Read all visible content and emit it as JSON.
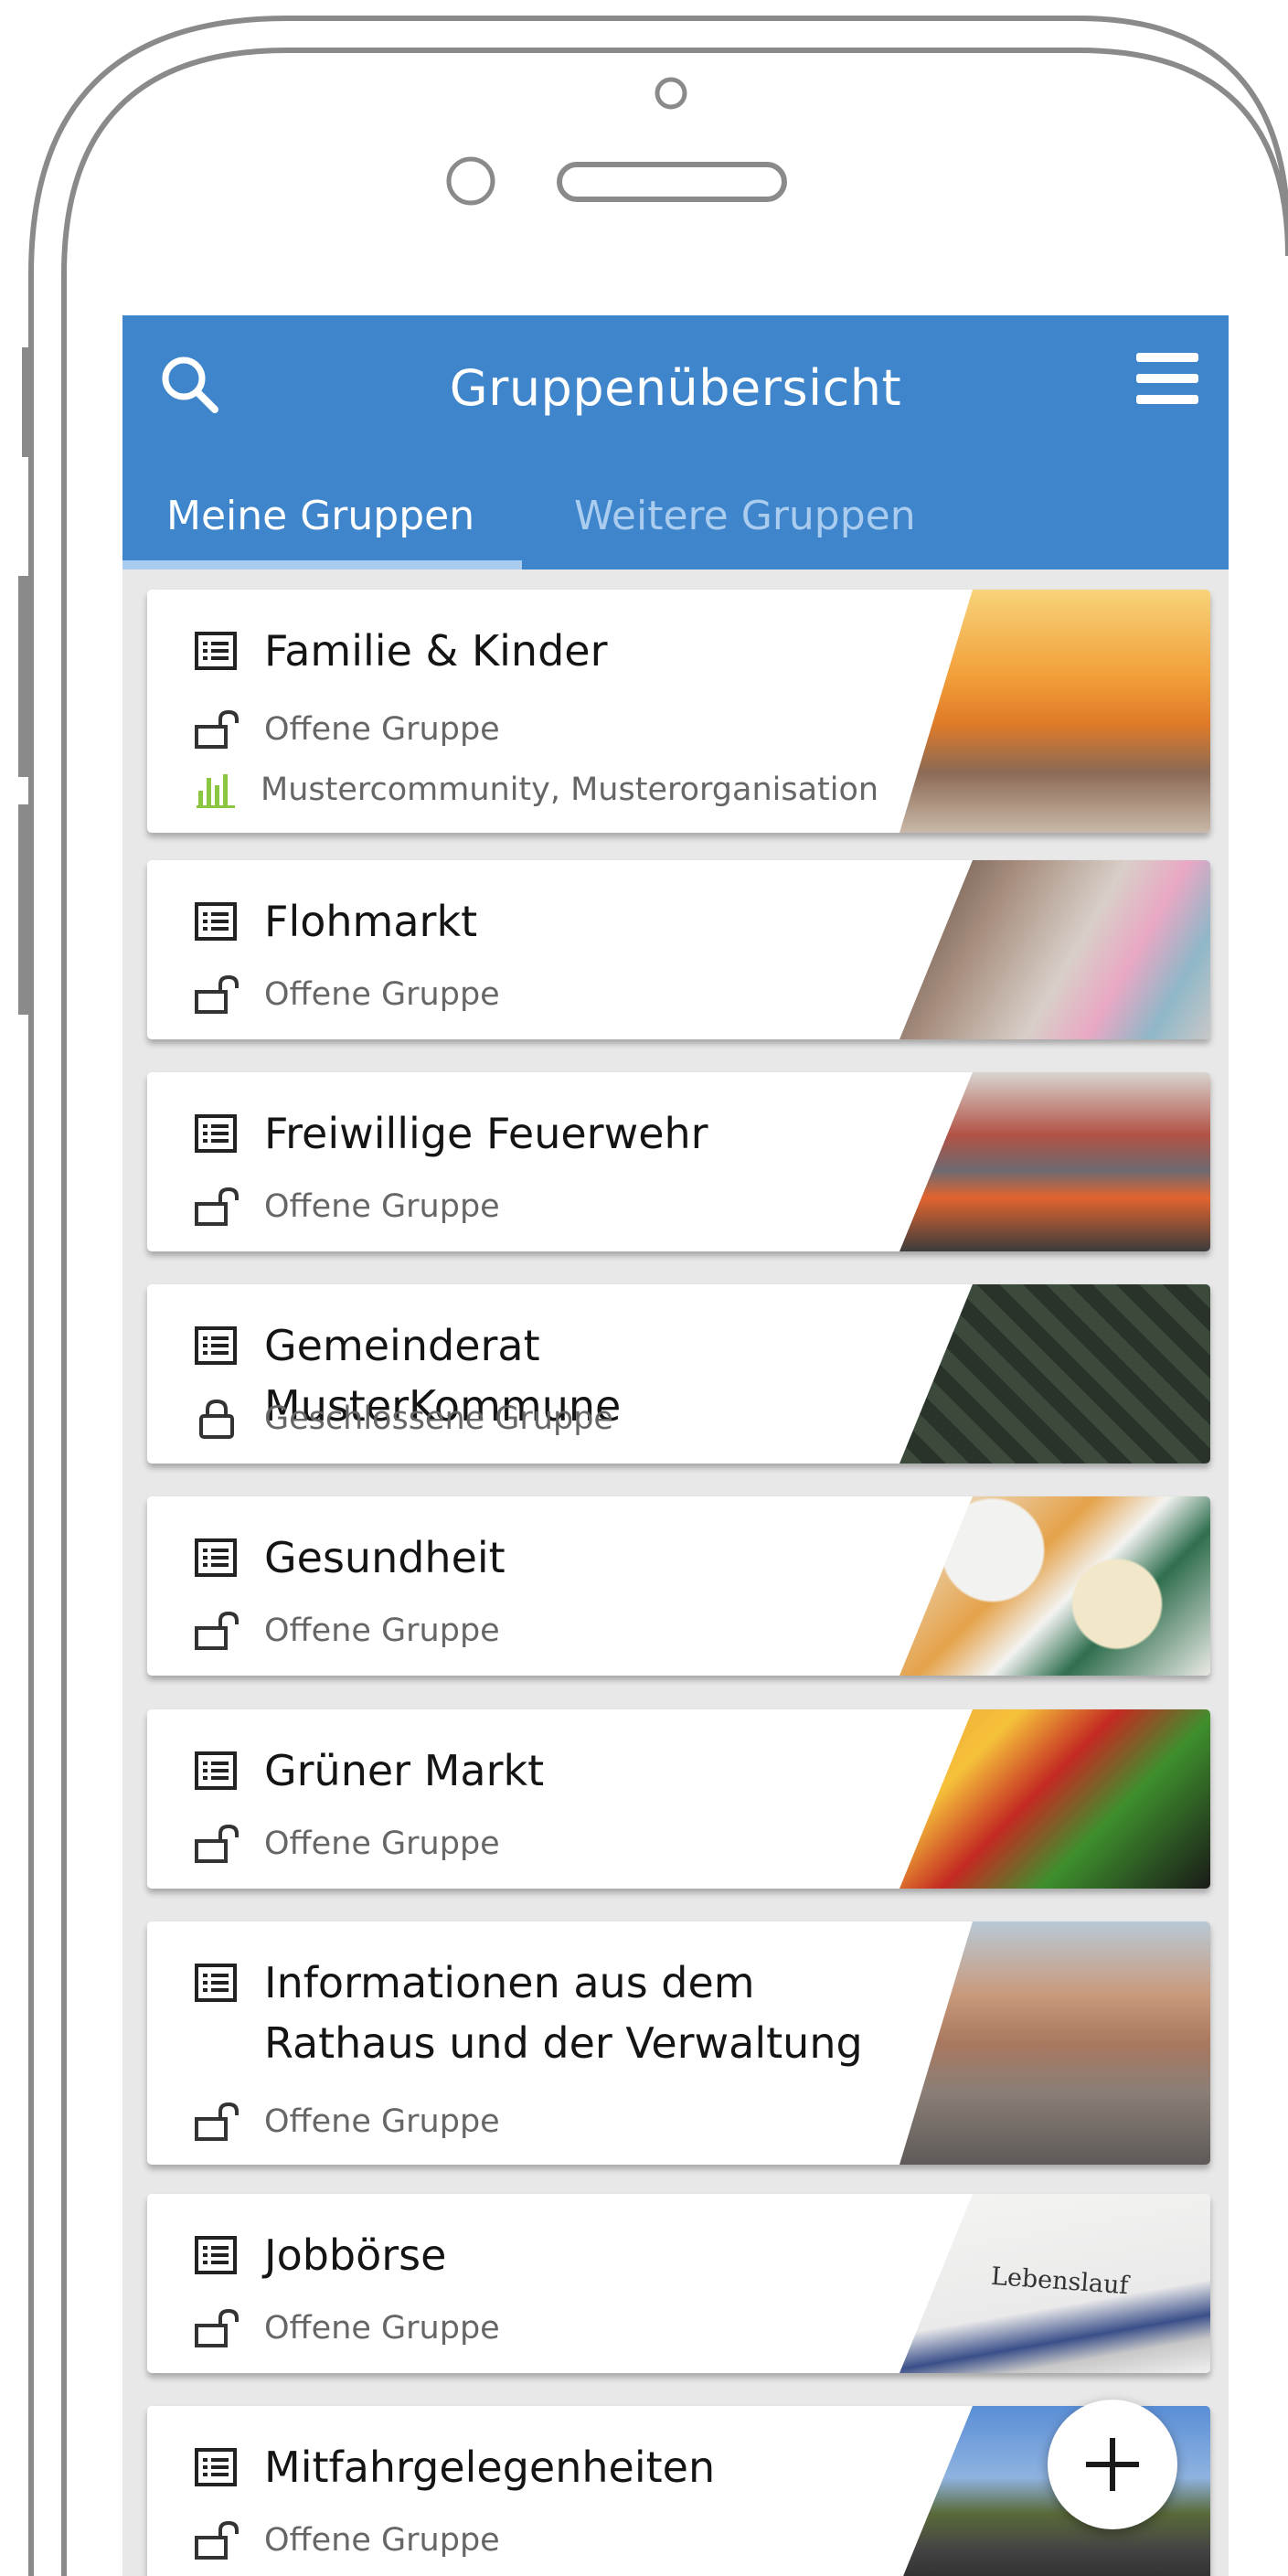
{
  "header": {
    "title": "Gruppenübersicht",
    "search_icon": "search-icon",
    "menu_icon": "hamburger-menu-icon",
    "color": "#3e85cb"
  },
  "tabs": [
    {
      "label": "Meine Gruppen",
      "active": true
    },
    {
      "label": "Weitere Gruppen",
      "active": false
    }
  ],
  "groups": [
    {
      "name": "Familie & Kinder",
      "status": "Offene Gruppe",
      "locked": false,
      "org": "Mustercommunity, Musterorganisation",
      "image": "mother-child-beach-sunset"
    },
    {
      "name": "Flohmarkt",
      "status": "Offene Gruppe",
      "locked": false,
      "image": "shopping-bags"
    },
    {
      "name": "Freiwillige Feuerwehr",
      "status": "Offene Gruppe",
      "locked": false,
      "image": "firefighters"
    },
    {
      "name": "Gemeinderat MusterKommune",
      "status": "Geschlossene Gruppe",
      "locked": true,
      "image": "meeting-table"
    },
    {
      "name": "Gesundheit",
      "status": "Offene Gruppe",
      "locked": false,
      "image": "pills-thermometer"
    },
    {
      "name": "Grüner Markt",
      "status": "Offene Gruppe",
      "locked": false,
      "image": "vegetables-fruit"
    },
    {
      "name": "Informationen aus dem Rathaus und der Verwaltung",
      "name_lines": [
        "Informationen aus dem",
        "Rathaus und der Verwaltung"
      ],
      "status": "Offene Gruppe",
      "locked": false,
      "image": "city-rooftops"
    },
    {
      "name": "Jobbörse",
      "status": "Offene Gruppe",
      "locked": false,
      "image": "lebenslauf-document",
      "image_text": "Lebenslauf"
    },
    {
      "name": "Mitfahrgelegenheiten",
      "status": "Offene Gruppe",
      "locked": false,
      "image": "road-landscape"
    }
  ],
  "fab": {
    "icon": "plus-icon"
  }
}
